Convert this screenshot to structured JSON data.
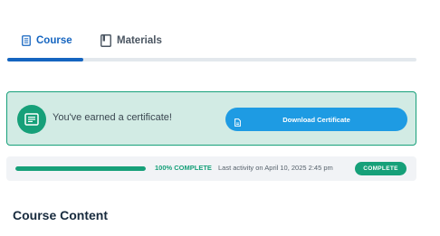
{
  "tabs": [
    {
      "label": "Course",
      "icon": "document-icon",
      "active": true
    },
    {
      "label": "Materials",
      "icon": "notebook-icon",
      "active": false
    }
  ],
  "certificate": {
    "message": "You've earned a certificate!",
    "icon": "certificate-icon",
    "button_label": "Download Certificate",
    "button_icon": "file-icon"
  },
  "progress": {
    "percent": 100,
    "label": "100% COMPLETE",
    "activity": "Last activity on April 10, 2025 2:45 pm",
    "badge": "COMPLETE"
  },
  "section": {
    "title": "Course Content"
  },
  "colors": {
    "primary_blue": "#1565c0",
    "button_blue": "#1e9be3",
    "success_green": "#16a079",
    "banner_bg": "#d2ebe4",
    "heading_navy": "#172a3d"
  }
}
